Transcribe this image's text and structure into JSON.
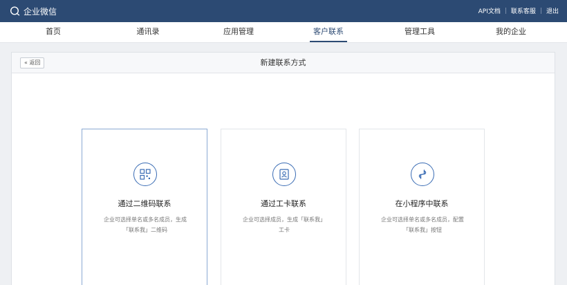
{
  "header": {
    "brand": "企业微信",
    "links": [
      "API文档",
      "联系客服",
      "退出"
    ]
  },
  "nav": {
    "items": [
      "首页",
      "通讯录",
      "应用管理",
      "客户联系",
      "管理工具",
      "我的企业"
    ],
    "active_index": 3
  },
  "panel": {
    "back_label": "« 返回",
    "title": "新建联系方式"
  },
  "cards": [
    {
      "title": "通过二维码联系",
      "desc_line1": "企业可选择单名或多名成员，生成",
      "desc_line2": "「联系我」二维码",
      "icon": "qrcode-icon"
    },
    {
      "title": "通过工卡联系",
      "desc_line1": "企业可选择成员，生成「联系我」",
      "desc_line2": "工卡",
      "icon": "badge-icon"
    },
    {
      "title": "在小程序中联系",
      "desc_line1": "企业可选择单名或多名成员，配置",
      "desc_line2": "「联系我」按钮",
      "icon": "miniprogram-icon"
    }
  ],
  "colors": {
    "topbar": "#2c4a73",
    "accent": "#3a6cb4"
  }
}
